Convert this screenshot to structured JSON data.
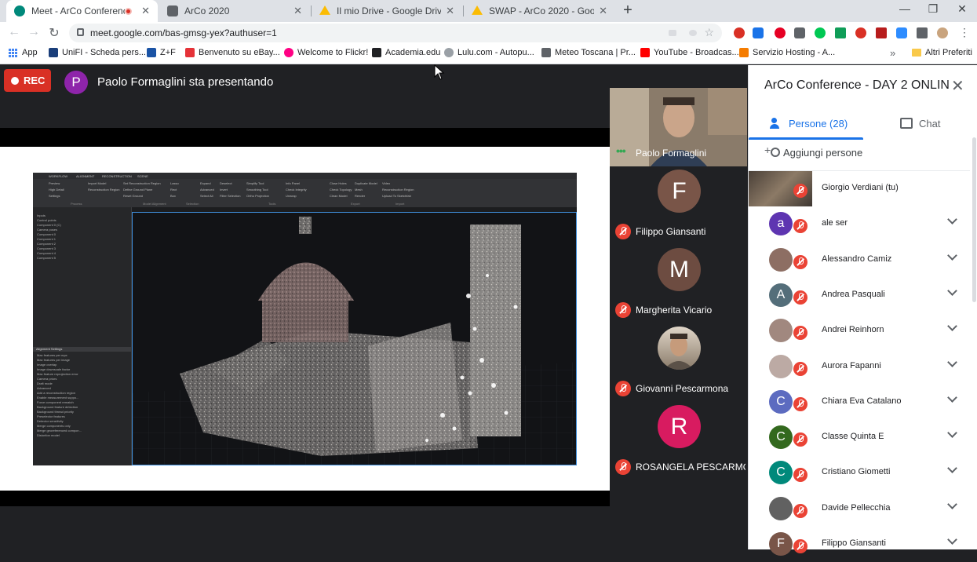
{
  "browser": {
    "tabs": [
      {
        "title": "Meet - ArCo Conference - D/",
        "favicon_color": "#00897b",
        "recording": true
      },
      {
        "title": "ArCo 2020",
        "favicon_color": "#5f6368",
        "recording": false
      },
      {
        "title": "Il mio Drive - Google Drive",
        "favicon_color": "#fbbc04",
        "recording": false
      },
      {
        "title": "SWAP - ArCo 2020 - Google Drive",
        "favicon_color": "#fbbc04",
        "recording": false
      }
    ],
    "new_tab": "+",
    "window_controls": {
      "minimize": "—",
      "maximize": "❐",
      "close": "✕"
    },
    "url": "meet.google.com/bas-gmsg-yex?authuser=1",
    "bookmarks": [
      {
        "label": "App",
        "icon": "apps-grid-icon"
      },
      {
        "label": "UniFI - Scheda pers...",
        "icon": "unifi-icon",
        "color": "#1a3e7a"
      },
      {
        "label": "Z+F",
        "icon": "zf-icon",
        "color": "#1a53a5"
      },
      {
        "label": "Benvenuto su eBay...",
        "icon": "ebay-icon",
        "color": "#e53238"
      },
      {
        "label": "Welcome to Flickr!",
        "icon": "flickr-icon",
        "color": "#ff0084"
      },
      {
        "label": "Academia.edu",
        "icon": "academia-icon",
        "color": "#202124"
      },
      {
        "label": "Lulu.com - Autopu...",
        "icon": "lulu-icon",
        "color": "#9aa0a6"
      },
      {
        "label": "Meteo Toscana | Pr...",
        "icon": "meteo-icon",
        "color": "#5f6368"
      },
      {
        "label": "YouTube - Broadcas...",
        "icon": "youtube-icon",
        "color": "#ff0000"
      },
      {
        "label": "Servizio Hosting - A...",
        "icon": "aruba-icon",
        "color": "#f57c00"
      }
    ],
    "more_bookmarks": "»",
    "other_bookmarks": "Altri Preferiti"
  },
  "stage": {
    "rec_label": "REC",
    "presenter_initial": "P",
    "presenting_text": "Paolo Formaglini sta presentando"
  },
  "slide_app": {
    "ribbon_tabs": [
      "WORKFLOW",
      "ALIGNMENT",
      "RECONSTRUCTION",
      "SCENE"
    ],
    "ribbon_groups": [
      "Process",
      "Model Alignment",
      "Selection",
      "Tools",
      "Export",
      "Import"
    ],
    "ribbon_items": [
      "Preview",
      "High Detail",
      "Settings",
      "Set Reconstruction Region",
      "Define Ground Plane",
      "Reset Ground",
      "Lasso",
      "Rect",
      "Box",
      "Expand",
      "Advanced",
      "Select All",
      "Deselect",
      "Invert",
      "Filter Selection",
      "Simplify Tool",
      "Smoothing Tool",
      "Ortho Projection",
      "Info Panel",
      "Check Integrity",
      "Unwrap",
      "Close Holes",
      "Check Topology",
      "Clean Model",
      "Duplicate Model",
      "Mesh",
      "Render",
      "Video",
      "Reconstruction Region",
      "Upload To Sketchfab",
      "Import Model",
      "Reconstruction Region"
    ],
    "tree_items": [
      "Inputs",
      "Control points",
      "Component 0 (C)",
      "Camera poses",
      "Component 0",
      "Component 1",
      "Component 2",
      "Component 3",
      "Component 4",
      "Component 5"
    ],
    "settings_title": "Alignment Settings",
    "settings_rows": [
      "Max features per mpx",
      "Max features per image",
      "Image overlap",
      "Image downscale factor",
      "Max feature reprojection error",
      "Camera priors",
      "Draft mode",
      "Advanced",
      "Add a reconstruction region",
      "Enable measurement suppo...",
      "Force component rematch",
      "Background feature detection",
      "Background thread priority",
      "Preselector features",
      "Detector sensitivity",
      "Merge components only",
      "Merge georeferenced compon...",
      "Distortion model"
    ]
  },
  "participants_strip": [
    {
      "name": "Paolo Formaglini",
      "type": "camera",
      "speaking": true
    },
    {
      "name": "Filippo Giansanti",
      "type": "avatar",
      "initial": "F",
      "color": "#795548",
      "muted": true
    },
    {
      "name": "Margherita Vicario",
      "type": "avatar",
      "initial": "M",
      "color": "#6d4c41",
      "muted": true
    },
    {
      "name": "Giovanni Pescarmona",
      "type": "photo",
      "muted": true
    },
    {
      "name": "ROSANGELA PESCARMO...",
      "type": "avatar",
      "initial": "R",
      "color": "#d81b60",
      "muted": true
    }
  ],
  "panel": {
    "title": "ArCo Conference - DAY 2 ONLIN...",
    "tabs": {
      "people": "Persone (28)",
      "chat": "Chat"
    },
    "add_people": "Aggiungi persone",
    "people": [
      {
        "name": "Giorgio Verdiani (tu)",
        "avatar": "photo",
        "self": true
      },
      {
        "name": "ale ser",
        "initial": "a",
        "color": "#5e35b1"
      },
      {
        "name": "Alessandro Camiz",
        "avatar": "photo",
        "color": "#8d6e63"
      },
      {
        "name": "Andrea Pasquali",
        "initial": "A",
        "color": "#546e7a"
      },
      {
        "name": "Andrei Reinhorn",
        "avatar": "photo",
        "color": "#a1887f"
      },
      {
        "name": "Aurora Fapanni",
        "avatar": "photo",
        "color": "#bcaaa4"
      },
      {
        "name": "Chiara Eva Catalano",
        "initial": "C",
        "color": "#5c6bc0"
      },
      {
        "name": "Classe Quinta E",
        "initial": "C",
        "color": "#33691e"
      },
      {
        "name": "Cristiano Giometti",
        "initial": "C",
        "color": "#00897b"
      },
      {
        "name": "Davide Pellecchia",
        "avatar": "photo",
        "color": "#616161"
      },
      {
        "name": "Filippo Giansanti",
        "initial": "F",
        "color": "#795548"
      }
    ]
  }
}
